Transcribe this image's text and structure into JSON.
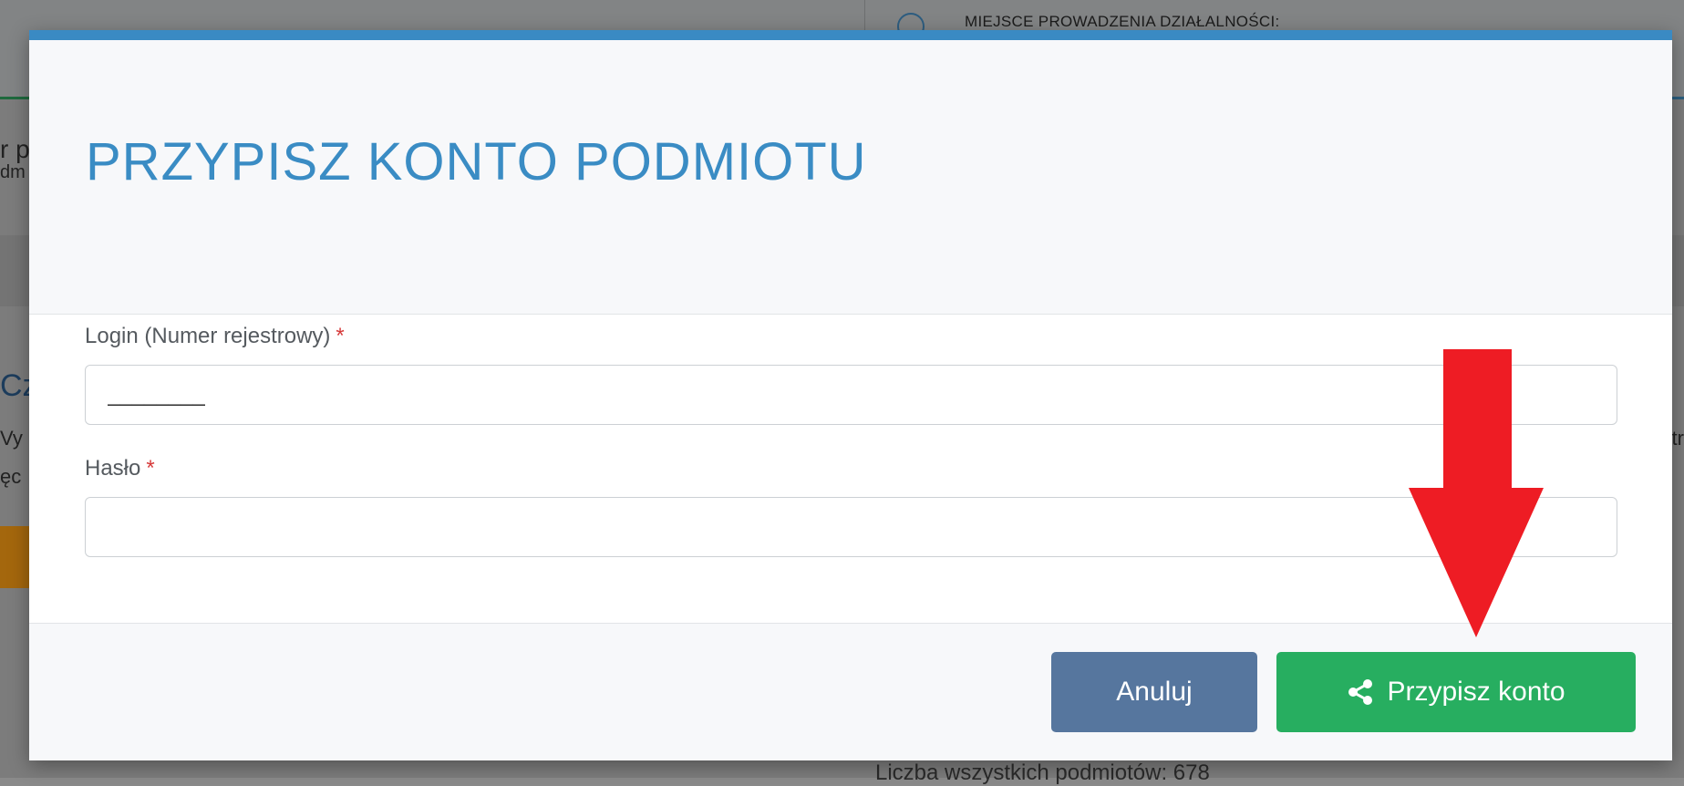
{
  "background": {
    "header_text": "MIEJSCE PROWADZENIA DZIAŁALNOŚCI:",
    "left_fragments": [
      "r p",
      "dm",
      "Cz",
      "Vy",
      "ęc"
    ],
    "right_fragment": "tr",
    "bottom_text": "Liczba wszystkich podmiotów: 678"
  },
  "modal": {
    "title": "PRZYPISZ KONTO PODMIOTU",
    "fields": [
      {
        "label": "Login (Numer rejestrowy)",
        "required_mark": "*",
        "value": "________",
        "placeholder": ""
      },
      {
        "label": "Hasło",
        "required_mark": "*",
        "value": "",
        "placeholder": ""
      }
    ],
    "buttons": {
      "cancel": "Anuluj",
      "assign": "Przypisz konto"
    }
  },
  "icons": {
    "assign_button_icon": "share-icon"
  },
  "colors": {
    "title": "#3a8cc4",
    "accent_bar": "#3a8ac3",
    "cancel_button": "#56769e",
    "assign_button": "#27ae60",
    "annotation_arrow": "#ee1c24",
    "required_mark": "#d63a3a"
  }
}
